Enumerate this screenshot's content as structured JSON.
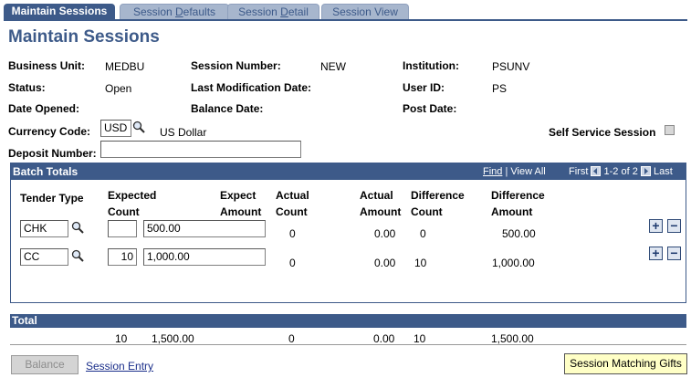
{
  "tabs": [
    {
      "label": "Maintain Sessions",
      "active": true
    },
    {
      "label_pre": "Session ",
      "label_u": "D",
      "label_post": "efaults",
      "active": false
    },
    {
      "label_pre": "Session ",
      "label_u": "D",
      "label_post": "etail",
      "active": false
    },
    {
      "label": "Session View",
      "active": false
    }
  ],
  "page_title": "Maintain Sessions",
  "fields": {
    "business_unit_label": "Business Unit:",
    "business_unit_value": "MEDBU",
    "session_number_label": "Session Number:",
    "session_number_value": "NEW",
    "institution_label": "Institution:",
    "institution_value": "PSUNV",
    "status_label": "Status:",
    "status_value": "Open",
    "last_mod_label": "Last Modification Date:",
    "user_id_label": "User ID:",
    "user_id_value": "PS",
    "date_opened_label": "Date Opened:",
    "balance_date_label": "Balance Date:",
    "post_date_label": "Post Date:",
    "currency_code_label": "Currency Code:",
    "currency_code_value": "USD",
    "currency_desc": "US Dollar",
    "self_service_label": "Self Service Session",
    "deposit_number_label": "Deposit Number:",
    "deposit_number_value": ""
  },
  "batch": {
    "title": "Batch Totals",
    "nav_find": "Find",
    "nav_sep": " | ",
    "nav_view_all": "View All",
    "nav_first": "First",
    "nav_range": "1-2 of 2",
    "nav_last": "Last",
    "headers": {
      "tender_type": "Tender Type",
      "expected_count_1": "Expected",
      "expected_count_2": "Count",
      "expect_amount_1": "Expect",
      "expect_amount_2": "Amount",
      "actual_count_1": "Actual",
      "actual_count_2": "Count",
      "actual_amount_1": "Actual",
      "actual_amount_2": "Amount",
      "diff_count_1": "Difference",
      "diff_count_2": "Count",
      "diff_amount_1": "Difference",
      "diff_amount_2": "Amount"
    },
    "rows": [
      {
        "tender": "CHK",
        "expected_count": "",
        "expect_amount": "500.00",
        "actual_count": "0",
        "actual_amount": "0.00",
        "diff_count": "0",
        "diff_amount": "500.00"
      },
      {
        "tender": "CC",
        "expected_count": "10",
        "expect_amount": "1,000.00",
        "actual_count": "0",
        "actual_amount": "0.00",
        "diff_count": "10",
        "diff_amount": "1,000.00"
      }
    ]
  },
  "totals": {
    "title": "Total",
    "expected_count": "10",
    "expect_amount": "1,500.00",
    "actual_count": "0",
    "actual_amount": "0.00",
    "diff_count": "10",
    "diff_amount": "1,500.00"
  },
  "footer": {
    "balance_button": "Balance",
    "session_entry_link": "Session Entry",
    "matching_gifts_button": "Session Matching Gifts"
  },
  "colors": {
    "header_blue": "#3d5a89",
    "tab_inactive": "#a7b6cd",
    "button_yellow": "#ffffc6"
  }
}
